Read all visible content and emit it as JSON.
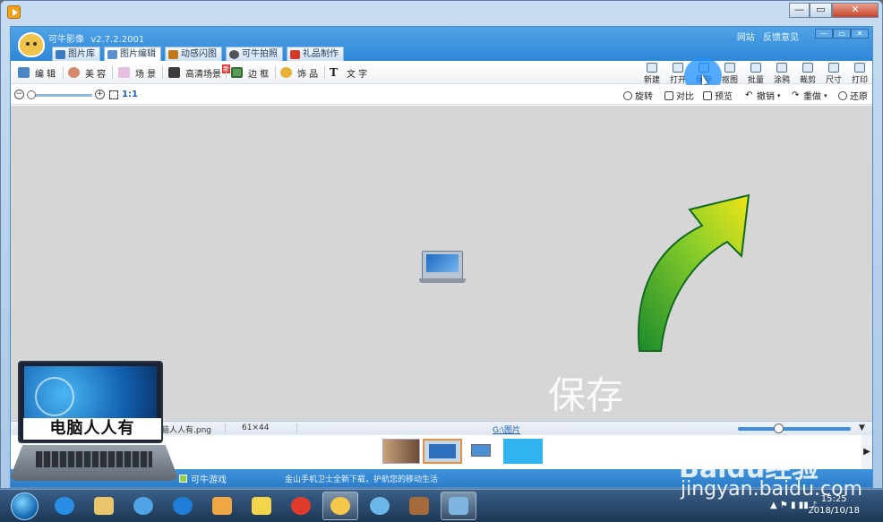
{
  "app": {
    "name": "可牛影像",
    "version": "v2.7.2.2001",
    "top_links": [
      "网站",
      "反馈意见"
    ],
    "nav_tabs": [
      {
        "label": "图片库",
        "icon": "gallery-icon"
      },
      {
        "label": "图片编辑",
        "icon": "edit-picture-icon",
        "active": true
      },
      {
        "label": "动感闪图",
        "icon": "animation-icon"
      },
      {
        "label": "可牛拍照",
        "icon": "camera-icon"
      },
      {
        "label": "礼品制作",
        "icon": "gift-icon"
      }
    ],
    "tools": [
      "编 辑",
      "美 容",
      "场 景",
      "高清场景",
      "边 框",
      "饰 品",
      "文 字"
    ],
    "hd_badge": "新",
    "right_tools": [
      "新建",
      "打开",
      "保存",
      "抠图",
      "批量",
      "涂鸦",
      "裁剪",
      "尺寸",
      "打印"
    ],
    "zoom_label": "1:1",
    "sub_actions": [
      "旋转",
      "对比",
      "预览",
      "撤销",
      "重做",
      "还原"
    ]
  },
  "canvas": {
    "overlay_text": "保存"
  },
  "status": {
    "filename": "电脑人人有.png",
    "dimensions": "61×44",
    "path": "G:\\图片"
  },
  "bottom": {
    "game_link": "可牛游戏",
    "promo": "金山手机卫士全新下载，护航您的移动生活"
  },
  "taskbar": {
    "time": "15:25",
    "date": "2018/10/18"
  },
  "watermark": {
    "laptop_label": "电脑人人有",
    "baidu": "Baidu经验",
    "url": "jingyan.baidu.com"
  },
  "colors": {
    "accent": "#2f87d7",
    "arrow_start": "#1b8a2c",
    "arrow_end": "#f0e417",
    "highlight": "#1e90ff"
  }
}
